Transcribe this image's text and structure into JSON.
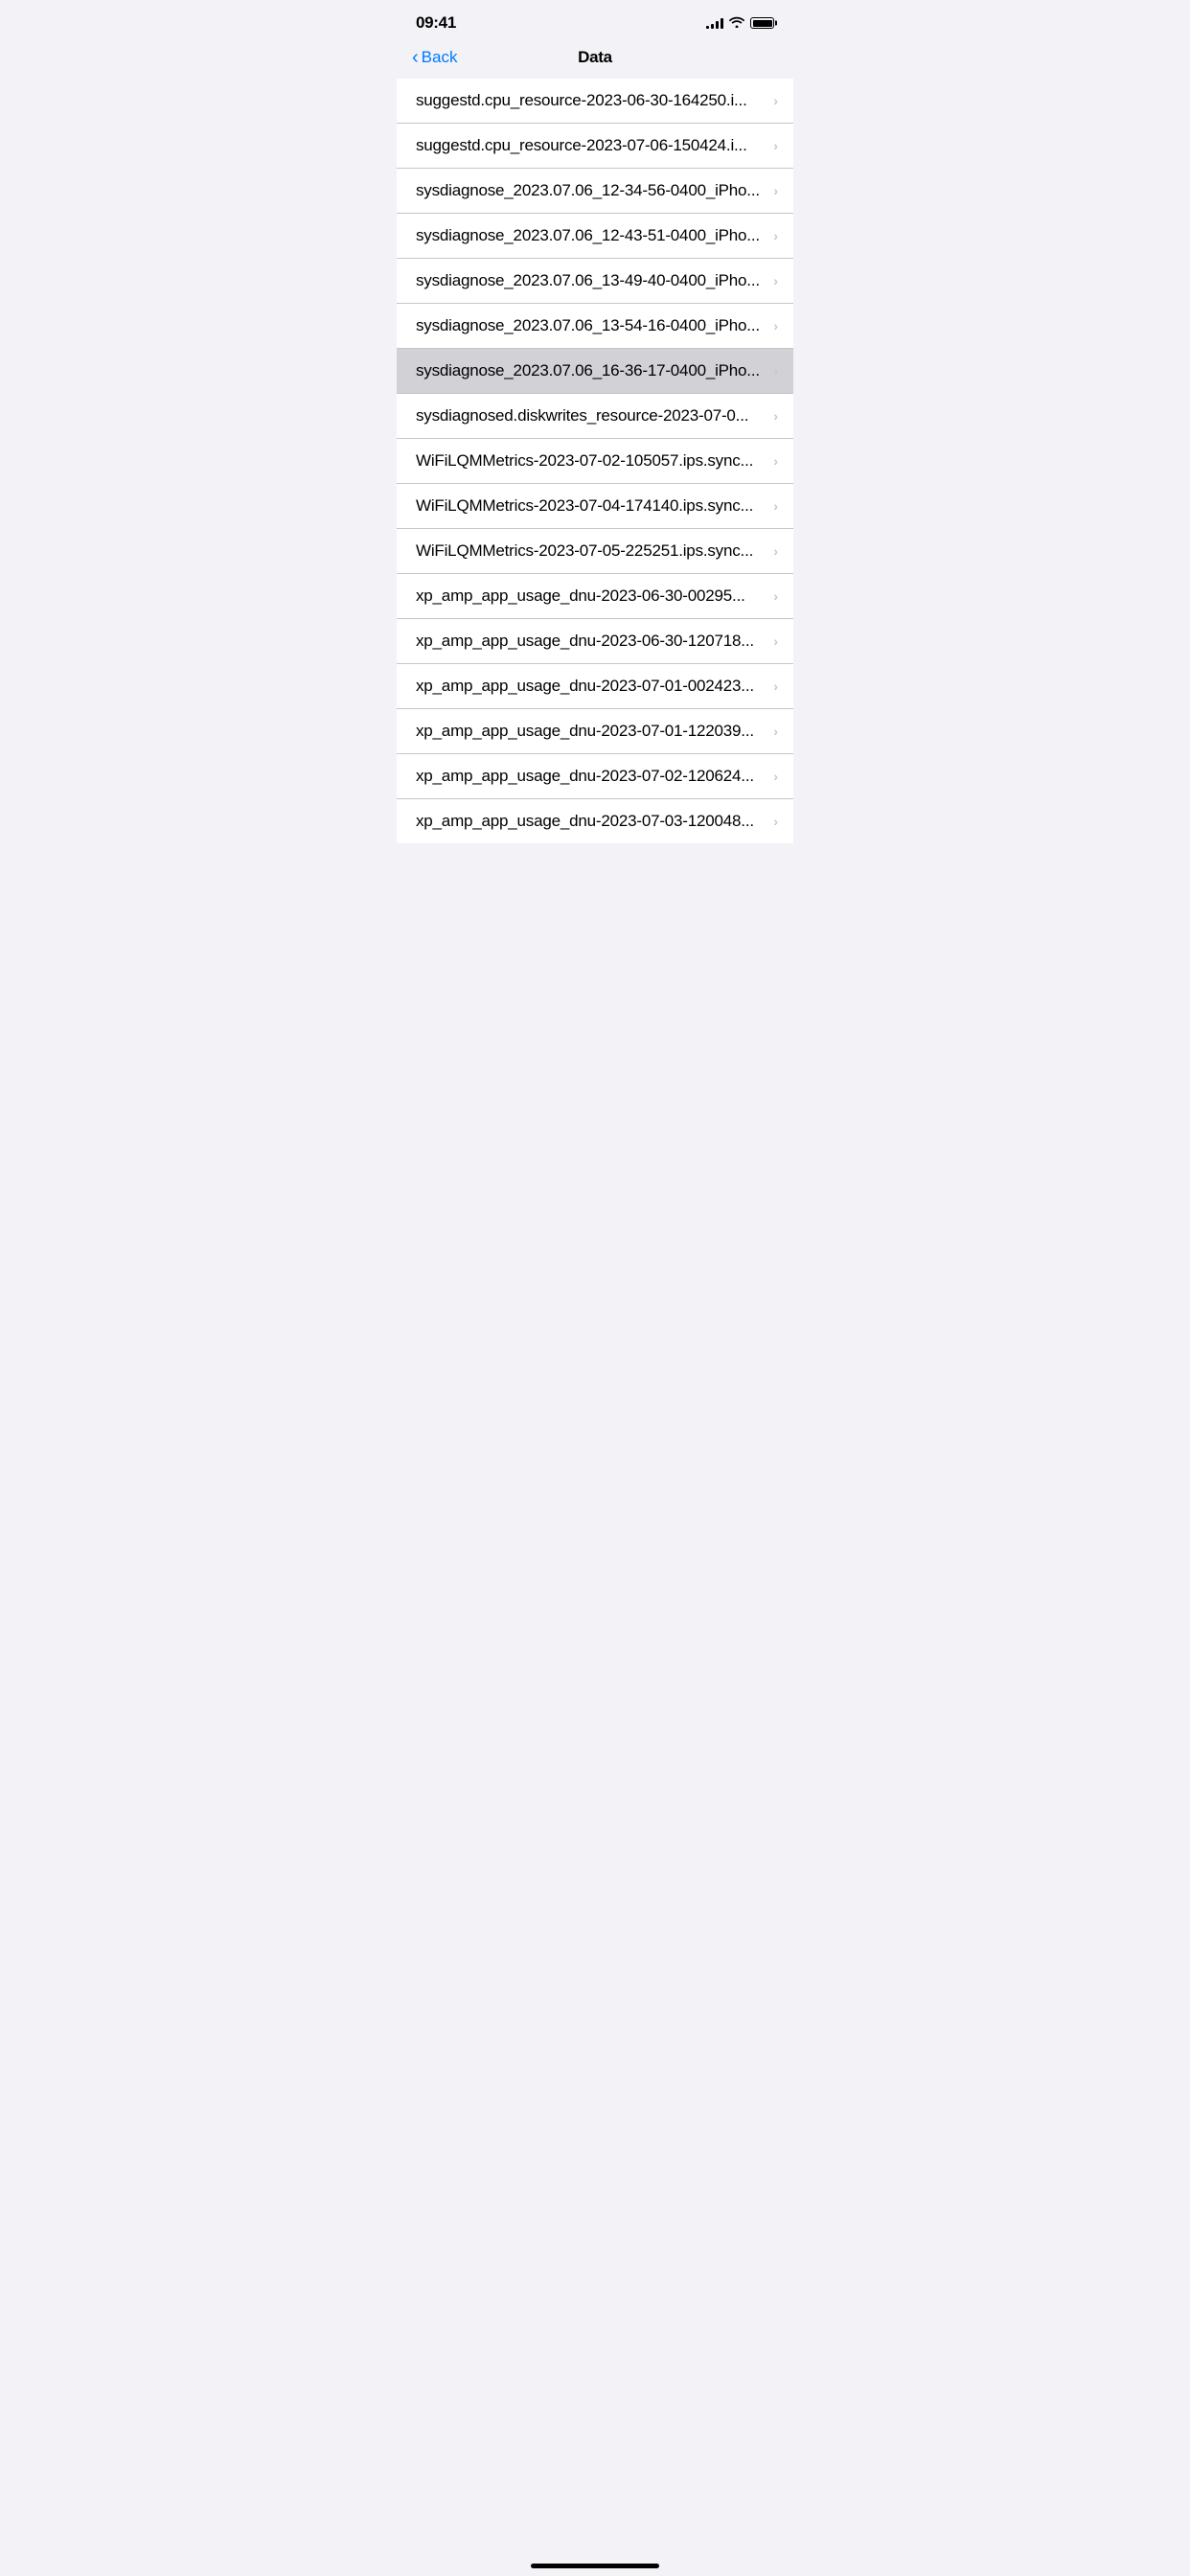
{
  "statusBar": {
    "time": "09:41",
    "signal": [
      3,
      5,
      7,
      9,
      11
    ],
    "wifi": "wifi",
    "battery": "full"
  },
  "navBar": {
    "backLabel": "Back",
    "title": "Data"
  },
  "listItems": [
    {
      "id": "item-1",
      "label": "suggestd.cpu_resource-2023-06-30-164250.i...",
      "highlighted": false
    },
    {
      "id": "item-2",
      "label": "suggestd.cpu_resource-2023-07-06-150424.i...",
      "highlighted": false
    },
    {
      "id": "item-3",
      "label": "sysdiagnose_2023.07.06_12-34-56-0400_iPho...",
      "highlighted": false
    },
    {
      "id": "item-4",
      "label": "sysdiagnose_2023.07.06_12-43-51-0400_iPho...",
      "highlighted": false
    },
    {
      "id": "item-5",
      "label": "sysdiagnose_2023.07.06_13-49-40-0400_iPho...",
      "highlighted": false
    },
    {
      "id": "item-6",
      "label": "sysdiagnose_2023.07.06_13-54-16-0400_iPho...",
      "highlighted": false
    },
    {
      "id": "item-7",
      "label": "sysdiagnose_2023.07.06_16-36-17-0400_iPho...",
      "highlighted": true
    },
    {
      "id": "item-8",
      "label": "sysdiagnosed.diskwrites_resource-2023-07-0...",
      "highlighted": false
    },
    {
      "id": "item-9",
      "label": "WiFiLQMMetrics-2023-07-02-105057.ips.sync...",
      "highlighted": false
    },
    {
      "id": "item-10",
      "label": "WiFiLQMMetrics-2023-07-04-174140.ips.sync...",
      "highlighted": false
    },
    {
      "id": "item-11",
      "label": "WiFiLQMMetrics-2023-07-05-225251.ips.sync...",
      "highlighted": false
    },
    {
      "id": "item-12",
      "label": "xp_amp_app_usage_dnu-2023-06-30-00295...",
      "highlighted": false
    },
    {
      "id": "item-13",
      "label": "xp_amp_app_usage_dnu-2023-06-30-120718...",
      "highlighted": false
    },
    {
      "id": "item-14",
      "label": "xp_amp_app_usage_dnu-2023-07-01-002423...",
      "highlighted": false
    },
    {
      "id": "item-15",
      "label": "xp_amp_app_usage_dnu-2023-07-01-122039...",
      "highlighted": false
    },
    {
      "id": "item-16",
      "label": "xp_amp_app_usage_dnu-2023-07-02-120624...",
      "highlighted": false
    },
    {
      "id": "item-17",
      "label": "xp_amp_app_usage_dnu-2023-07-03-120048...",
      "highlighted": false
    }
  ]
}
